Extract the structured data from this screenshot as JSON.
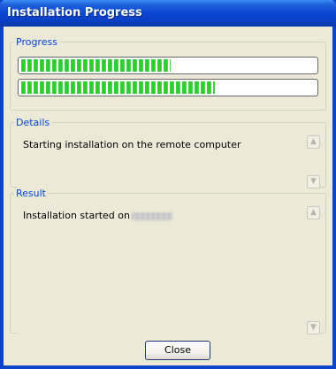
{
  "window": {
    "title": "Installation Progress"
  },
  "progress_group": {
    "legend": "Progress",
    "bars": [
      {
        "name": "overall",
        "fraction": 0.51
      },
      {
        "name": "current",
        "fraction": 0.66
      }
    ]
  },
  "details_group": {
    "legend": "Details",
    "text": "Starting installation on the remote computer"
  },
  "result_group": {
    "legend": "Result",
    "text": "Installation started on"
  },
  "buttons": {
    "close": "Close"
  },
  "colors": {
    "title_bar": "#0a46d6",
    "legend_text": "#0046d5",
    "progress_fill": "#3bd23b",
    "window_bg": "#ece9d8"
  }
}
